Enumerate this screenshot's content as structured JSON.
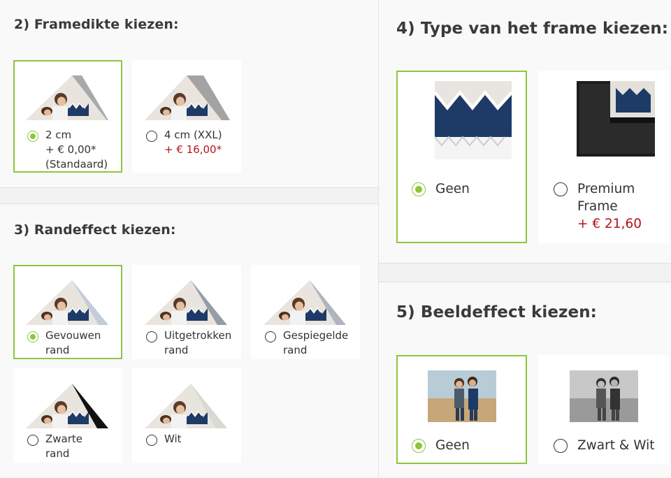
{
  "left": {
    "frame_thickness": {
      "title": "2) Framedikte kiezen:",
      "options": [
        {
          "line1": "2 cm",
          "line2": "+ € 0,00*",
          "line3": "(Standaard)",
          "selected": true
        },
        {
          "line1": "4 cm (XXL)",
          "price": "+ € 16,00*",
          "selected": false
        }
      ]
    },
    "edge_effect": {
      "title": "3) Randeffect kiezen:",
      "options": [
        {
          "line1": "Gevouwen",
          "line2": "rand",
          "selected": true
        },
        {
          "line1": "Uitgetrokken",
          "line2": "rand",
          "selected": false
        },
        {
          "line1": "Gespiegelde",
          "line2": "rand",
          "selected": false
        },
        {
          "line1": "Zwarte",
          "line2": "rand",
          "selected": false
        },
        {
          "line1": "Wit",
          "selected": false
        }
      ]
    }
  },
  "right": {
    "frame_type": {
      "title": "4) Type van het frame kiezen:",
      "options": [
        {
          "line1": "Geen",
          "selected": true
        },
        {
          "line1": "Premium",
          "line2": "Frame",
          "price": "+ € 21,60",
          "selected": false
        }
      ]
    },
    "image_effect": {
      "title": "5) Beeldeffect kiezen:",
      "options": [
        {
          "line1": "Geen",
          "selected": true
        },
        {
          "line1": "Zwart & Wit",
          "selected": false
        }
      ]
    }
  },
  "colors": {
    "accent": "#8cc63f",
    "price": "#b4141b"
  }
}
